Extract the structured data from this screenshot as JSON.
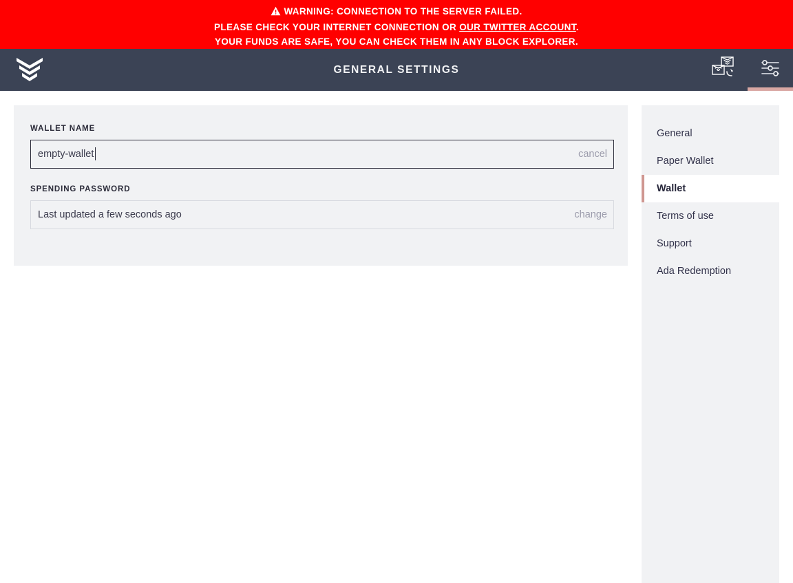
{
  "warning": {
    "icon": "warning-triangle-icon",
    "line1": "WARNING: CONNECTION TO THE SERVER FAILED.",
    "line2_before": "PLEASE CHECK YOUR INTERNET CONNECTION OR ",
    "line2_link": "OUR TWITTER ACCOUNT",
    "line2_after": ".",
    "line3": "YOUR FUNDS ARE SAFE, YOU CAN CHECK THEM IN ANY BLOCK EXPLORER.",
    "background_color": "#ff0000",
    "text_color": "#ffffff"
  },
  "topbar": {
    "logo_icon": "daedalus-chevron-logo-icon",
    "title": "GENERAL SETTINGS",
    "background_color": "#3b4355",
    "actions": [
      {
        "name": "wallet-switch-button",
        "icon": "wallet-switch-icon",
        "active": false
      },
      {
        "name": "settings-button",
        "icon": "sliders-icon",
        "active": true
      }
    ],
    "active_indicator_color": "#d9a8a4"
  },
  "main": {
    "panel_background": "#f1f2f4",
    "fields": [
      {
        "label": "WALLET NAME",
        "type": "input",
        "value": "empty-wallet",
        "placeholder": "",
        "action_label": "cancel",
        "focused": true
      },
      {
        "label": "SPENDING PASSWORD",
        "type": "static",
        "value": "Last updated a few seconds ago",
        "action_label": "change",
        "focused": false
      }
    ]
  },
  "settings_menu": {
    "background": "#f1f2f4",
    "active_border_color": "#cf9791",
    "items": [
      {
        "label": "General",
        "active": false
      },
      {
        "label": "Paper Wallet",
        "active": false
      },
      {
        "label": "Wallet",
        "active": true
      },
      {
        "label": "Terms of use",
        "active": false
      },
      {
        "label": "Support",
        "active": false
      },
      {
        "label": "Ada Redemption",
        "active": false
      }
    ]
  }
}
